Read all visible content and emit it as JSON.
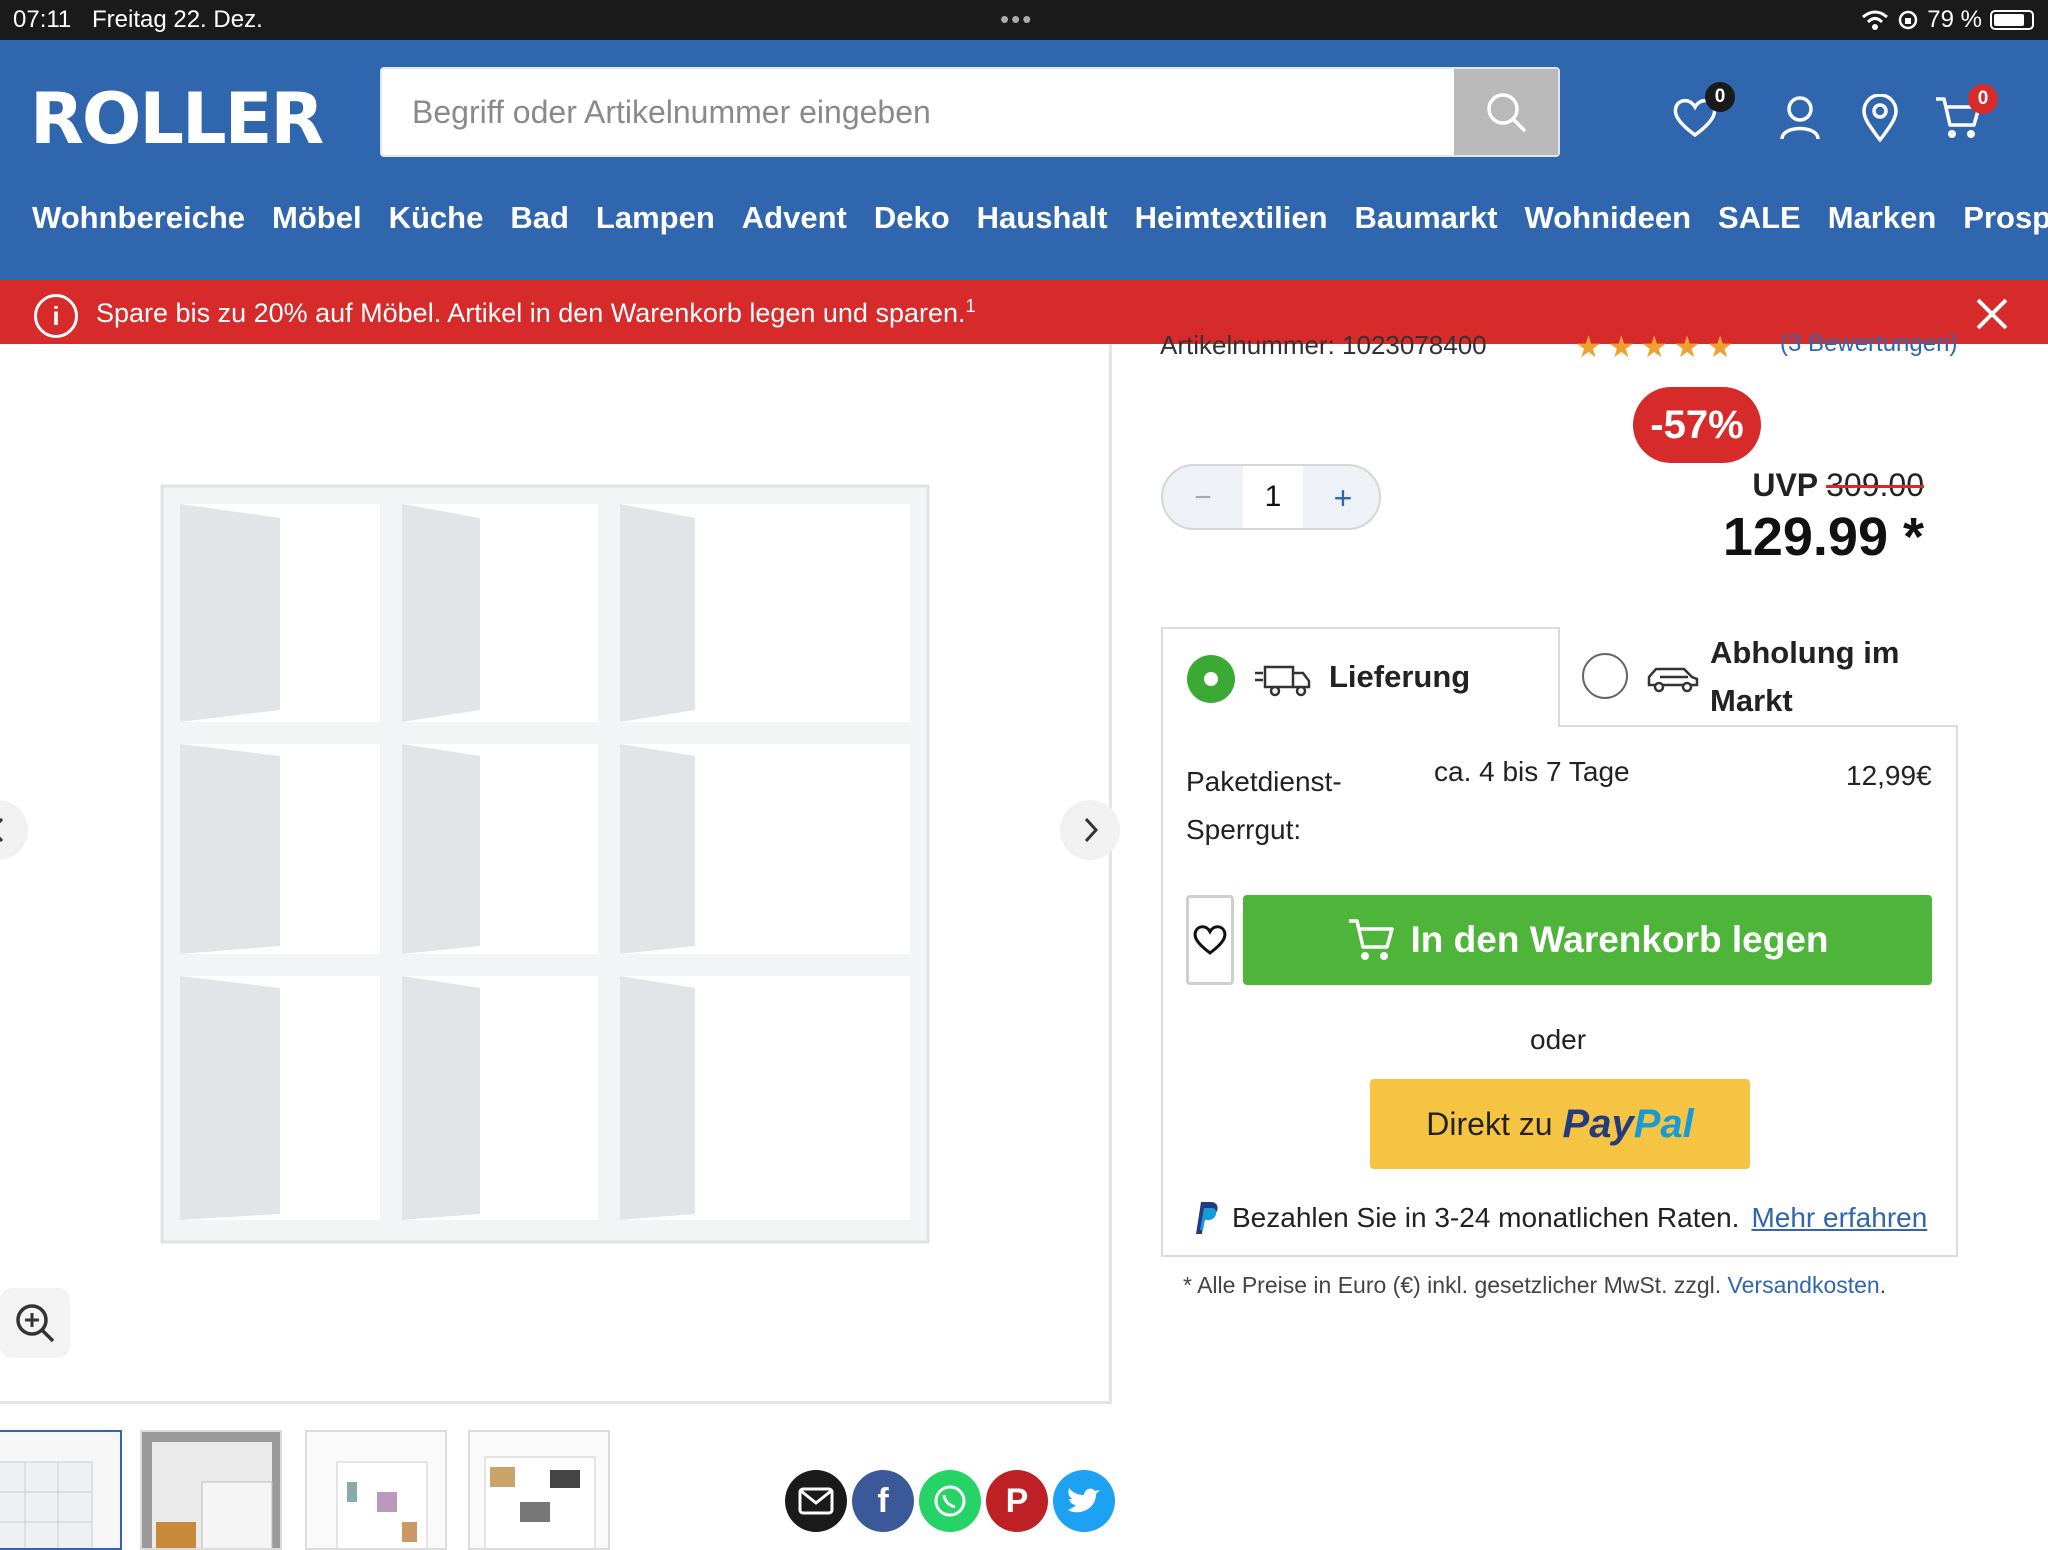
{
  "status_bar": {
    "time": "07:11",
    "date": "Freitag 22. Dez.",
    "battery": "79 %"
  },
  "header": {
    "logo": "ROLLER",
    "search": {
      "placeholder": "Begriff oder Artikelnummer eingeben",
      "value": ""
    },
    "wishlist_count": "0",
    "cart_count": "0",
    "nav": [
      "Wohnbereiche",
      "Möbel",
      "Küche",
      "Bad",
      "Lampen",
      "Advent",
      "Deko",
      "Haushalt",
      "Heimtextilien",
      "Baumarkt",
      "Wohnideen",
      "SALE",
      "Marken",
      "Prospekte"
    ]
  },
  "promo": {
    "text": "Spare bis zu 20% auf Möbel. Artikel in den Warenkorb legen und sparen.",
    "sup": "1"
  },
  "product": {
    "article_number_partial": "Artikelnummer: 1023078400",
    "rating_stars": 5,
    "reviews_partial": "(3 Bewertungen)",
    "discount": "-57%",
    "quantity": "1",
    "uvp_label": "UVP",
    "uvp_old": "309.00",
    "price": "129.99 *"
  },
  "delivery": {
    "tab_delivery": "Lieferung",
    "tab_pickup": "Abholung im Markt",
    "selected": "Lieferung",
    "shipping_label": "Paketdienst-Sperrgut:",
    "shipping_time": "ca. 4 bis 7 Tage",
    "shipping_price": "12,99€"
  },
  "actions": {
    "cart_button": "In den Warenkorb legen",
    "oder": "oder",
    "paypal_prefix": "Direkt zu",
    "paypal_logo_1": "Pay",
    "paypal_logo_2": "Pal",
    "installments_text": "Bezahlen Sie in 3-24 monatlichen Raten.",
    "installments_link": "Mehr erfahren"
  },
  "footnote": {
    "text": "* Alle Preise in Euro (€) inkl. gesetzlicher MwSt. zzgl.",
    "link": "Versandkosten",
    "end": "."
  },
  "colors": {
    "brand_blue": "#2f66ad",
    "promo_red": "#d72a2a",
    "cart_green": "#4eb53a",
    "paypal_yellow": "#f6c443"
  }
}
